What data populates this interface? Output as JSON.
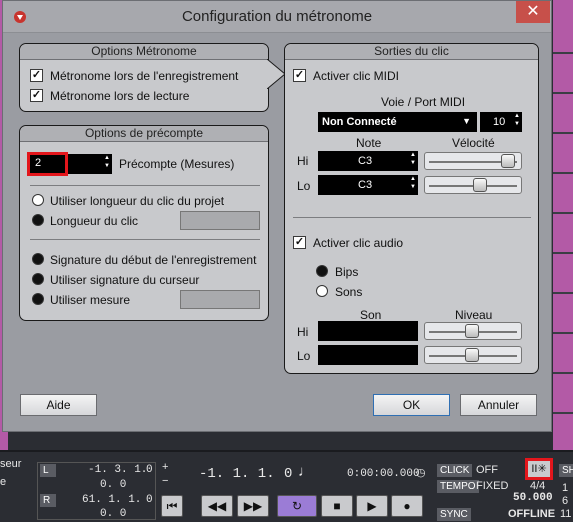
{
  "dialog": {
    "title": "Configuration du métronome",
    "close_icon": "close-icon"
  },
  "options_metronome": {
    "title": "Options Métronome",
    "items": [
      {
        "label": "Métronome lors de l'enregistrement",
        "checked": true
      },
      {
        "label": "Métronome lors de lecture",
        "checked": true
      }
    ]
  },
  "options_precompte": {
    "title": "Options de précompte",
    "count_value": "2",
    "count_label": "Précompte (Mesures)",
    "radio_group1": [
      {
        "label": "Utiliser longueur du clic du projet",
        "selected": false
      },
      {
        "label": "Longueur du clic",
        "selected": true
      }
    ],
    "radio_group2": [
      {
        "label": "Signature du début de l'enregistrement",
        "selected": true
      },
      {
        "label": "Utiliser signature du curseur",
        "selected": true
      },
      {
        "label": "Utiliser mesure",
        "selected": true
      }
    ]
  },
  "sorties_clic": {
    "title": "Sorties du clic",
    "midi_label": "Activer clic MIDI",
    "midi_checked": true,
    "port_heading": "Voie / Port MIDI",
    "port_value": "Non Connecté",
    "channel_value": "10",
    "note_heading": "Note",
    "velocity_heading": "Vélocité",
    "hi_label": "Hi",
    "lo_label": "Lo",
    "hi_note": "C3",
    "lo_note": "C3",
    "hi_velocity": 0.95,
    "lo_velocity": 0.6,
    "audio_label": "Activer clic audio",
    "audio_checked": true,
    "bips_label": "Bips",
    "sons_label": "Sons",
    "son_heading": "Son",
    "niveau_heading": "Niveau",
    "hi_level": 0.5,
    "lo_level": 0.5
  },
  "buttons": {
    "help": "Aide",
    "ok": "OK",
    "cancel": "Annuler"
  },
  "transport": {
    "left_cut": [
      "seur",
      "e"
    ],
    "left_marker": "L",
    "right_marker": "R",
    "left_pos": "-1. 3. 1.",
    "left_ticks": "0",
    "right_pos": "61. 1. 1.",
    "right_ticks": "0",
    "zero1": "0. 0",
    "zero2": "0. 0",
    "main_pos": "-1. 1. 1.",
    "main_ticks": "0",
    "time": "0:00:00.000",
    "click_tag": "CLICK",
    "click_value": "OFF",
    "tempo_tag": "TEMPO",
    "tempo_mode": "FIXED",
    "signature": "4/4",
    "tempo_value": "50.000",
    "sync_tag": "SYNC",
    "sync_value": "OFFLINE",
    "right_cut": "SH",
    "right_nums": [
      "1",
      "6",
      "11"
    ]
  },
  "colors": {
    "highlight": "#e3161c",
    "panel": "#c8c9cc",
    "loop_button": "#9b7cd6"
  }
}
